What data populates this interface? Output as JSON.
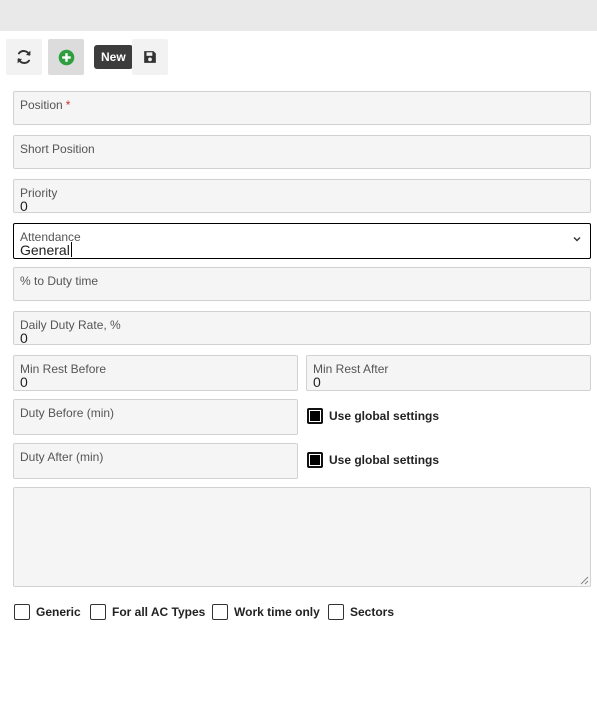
{
  "toolbar": {
    "refresh_icon": "refresh-icon",
    "add_icon": "plus-circle-icon",
    "new_tooltip": "New",
    "save_icon": "floppy-disk-icon",
    "add_color": "#2e9e3e"
  },
  "form": {
    "position": {
      "label": "Position",
      "required_mark": "*",
      "value": ""
    },
    "short_position": {
      "label": "Short Position",
      "value": ""
    },
    "priority": {
      "label": "Priority",
      "value": "0"
    },
    "attendance": {
      "label": "Attendance",
      "value": "General"
    },
    "duty_time_pct": {
      "label": "% to Duty time",
      "value": ""
    },
    "daily_duty_rate": {
      "label": "Daily Duty Rate, %",
      "value": "0"
    },
    "min_rest_before": {
      "label": "Min Rest Before",
      "value": "0"
    },
    "min_rest_after": {
      "label": "Min Rest After",
      "value": "0"
    },
    "duty_before": {
      "label": "Duty Before (min)",
      "value": "",
      "global_label": "Use global settings",
      "global_checked": true
    },
    "duty_after": {
      "label": "Duty After (min)",
      "value": "",
      "global_label": "Use global settings",
      "global_checked": true
    },
    "notes": {
      "value": ""
    }
  },
  "flags": [
    {
      "label": "Generic",
      "checked": false
    },
    {
      "label": "For all AC Types",
      "checked": false
    },
    {
      "label": "Work time only",
      "checked": false
    },
    {
      "label": "Sectors",
      "checked": false
    }
  ]
}
